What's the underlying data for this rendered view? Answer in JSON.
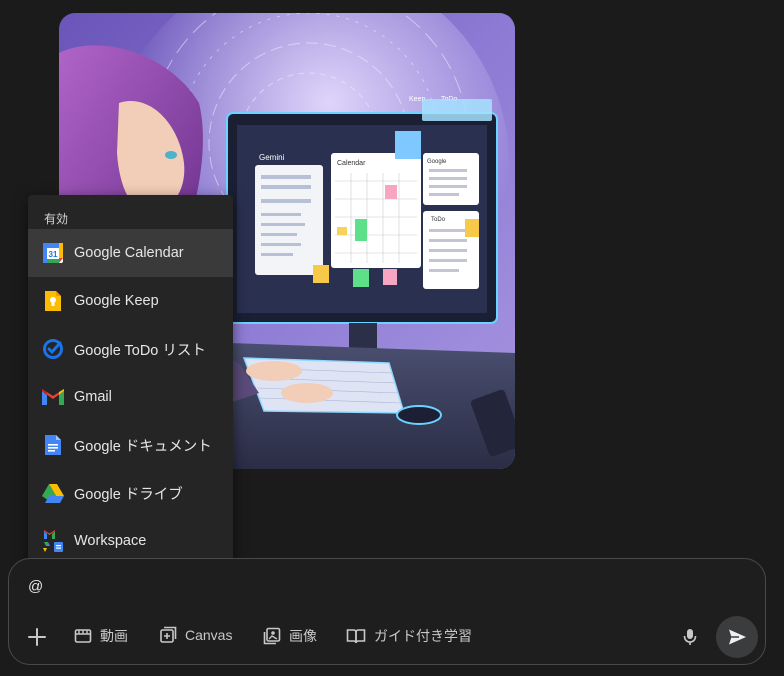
{
  "mention_menu": {
    "header": "有効",
    "items": [
      {
        "label": "Google Calendar",
        "icon": "google-calendar-icon",
        "active": true
      },
      {
        "label": "Google Keep",
        "icon": "google-keep-icon"
      },
      {
        "label": "Google ToDo リスト",
        "icon": "google-tasks-icon"
      },
      {
        "label": "Gmail",
        "icon": "gmail-icon"
      },
      {
        "label": "Google ドキュメント",
        "icon": "google-docs-icon"
      },
      {
        "label": "Google ドライブ",
        "icon": "google-drive-icon"
      },
      {
        "label": "Workspace",
        "icon": "workspace-icon"
      }
    ],
    "calendar_day": "31"
  },
  "generated_image": {
    "screen_labels": {
      "gemini": "Gemini",
      "calendar": "Calendar",
      "keep": "Keep",
      "todo": "ToDo",
      "google": "Google",
      "todo_panel": "ToDo"
    }
  },
  "prompt": {
    "text": "@",
    "tools": [
      "動画",
      "Canvas",
      "画像",
      "ガイド付き学習"
    ]
  },
  "colors": {
    "background": "#1b1b1b",
    "menu_bg": "#252526",
    "menu_active": "#3a3a3b",
    "send_bg": "#3b3c3e"
  }
}
